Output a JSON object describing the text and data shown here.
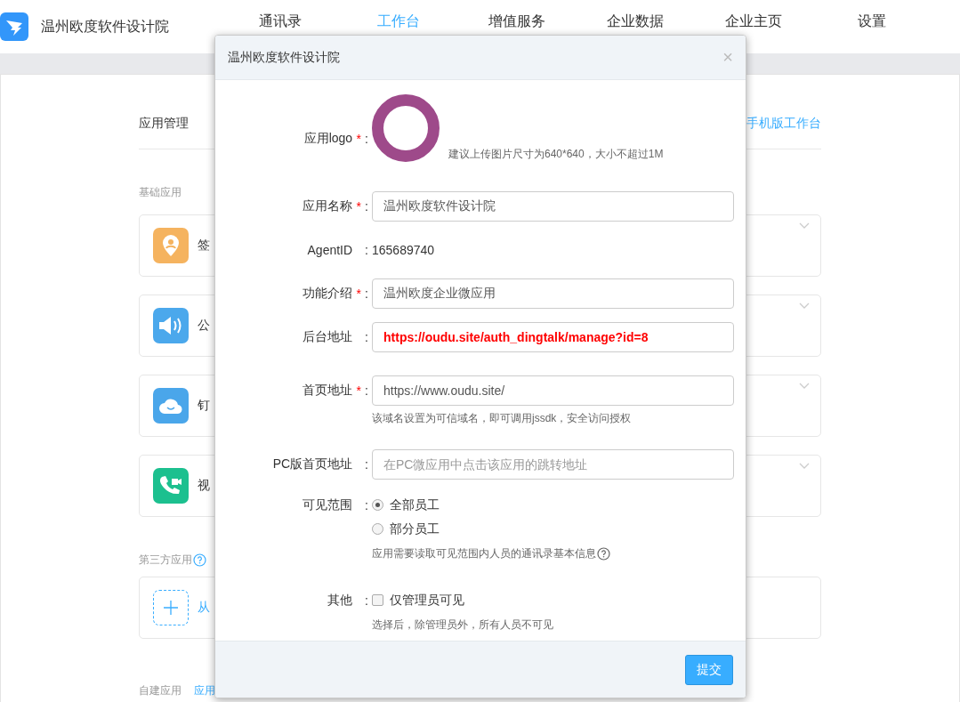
{
  "header": {
    "brand": "温州欧度软件设计院",
    "nav": [
      {
        "label": "通讯录",
        "selected": false
      },
      {
        "label": "工作台",
        "selected": true
      },
      {
        "label": "增值服务",
        "selected": false
      },
      {
        "label": "企业数据",
        "selected": false
      },
      {
        "label": "企业主页",
        "selected": false
      },
      {
        "label": "设置",
        "selected": false
      }
    ]
  },
  "page": {
    "title": "应用管理",
    "mobile_link": "手机版工作台",
    "basic_section": "基础应用",
    "basic_apps": [
      {
        "name": "签",
        "kind": "pin",
        "color": "#f5b35f"
      },
      {
        "name": "公",
        "kind": "speaker",
        "color": "#4ba8ec"
      },
      {
        "name": "钉",
        "kind": "cloud",
        "color": "#4aa6ea"
      },
      {
        "name": "视",
        "kind": "phone",
        "color": "#1cc08f"
      }
    ],
    "third_party_section": "第三方应用",
    "add_label": "从",
    "custom_section": "自建应用",
    "custom_link": "应用"
  },
  "dialog": {
    "title": "温州欧度软件设计院",
    "close": "×",
    "required_mark": "*",
    "colon": ":",
    "rows": [
      {
        "kind": "logo",
        "label": "应用logo",
        "required": true,
        "hint": "建议上传图片尺寸为640*640，大小不超过1M"
      },
      {
        "kind": "input",
        "label": "应用名称",
        "required": true,
        "value": "温州欧度软件设计院"
      },
      {
        "kind": "text",
        "label": "AgentID",
        "required": false,
        "value": "165689740"
      },
      {
        "kind": "input",
        "label": "功能介绍",
        "required": true,
        "value": "温州欧度企业微应用"
      },
      {
        "kind": "input",
        "label": "后台地址",
        "required": false,
        "value": "https://oudu.site/auth_dingtalk/manage?id=8",
        "highlighted": true
      },
      {
        "kind": "input",
        "label": "首页地址",
        "required": true,
        "value": "https://www.oudu.site/",
        "hint": "该域名设置为可信域名，即可调用jssdk，安全访问授权"
      },
      {
        "kind": "input",
        "label": "PC版首页地址",
        "required": false,
        "placeholder": "在PC微应用中点击该应用的跳转地址"
      },
      {
        "kind": "radio",
        "label": "可见范围",
        "required": false,
        "options": [
          {
            "label": "全部员工",
            "selected": true
          },
          {
            "label": "部分员工",
            "selected": false
          }
        ],
        "hint": "应用需要读取可见范围内人员的通讯录基本信息",
        "help": true
      },
      {
        "kind": "checkbox",
        "label": "其他",
        "required": false,
        "option": {
          "label": "仅管理员可见",
          "checked": false
        },
        "hint": "选择后，除管理员外，所有人员不可见"
      }
    ],
    "submit": "提交"
  }
}
